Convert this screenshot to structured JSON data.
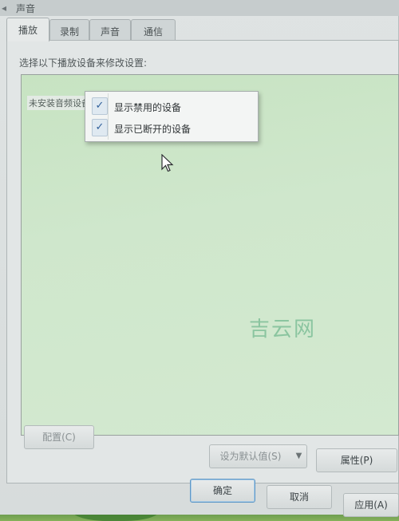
{
  "window": {
    "title": "声音"
  },
  "tabs": [
    {
      "label": "播放",
      "active": true
    },
    {
      "label": "录制",
      "active": false
    },
    {
      "label": "声音",
      "active": false
    },
    {
      "label": "通信",
      "active": false
    }
  ],
  "main": {
    "instruction": "选择以下播放设备来修改设置:",
    "empty_label": "未安装音频设备"
  },
  "context_menu": {
    "items": [
      {
        "label": "显示禁用的设备",
        "checked": true
      },
      {
        "label": "显示已断开的设备",
        "checked": true
      }
    ]
  },
  "buttons": {
    "configure": "配置(C)",
    "set_default": "设为默认值(S)",
    "properties": "属性(P)",
    "ok": "确定",
    "cancel": "取消",
    "apply": "应用(A)"
  },
  "watermark": "吉云网",
  "colors": {
    "list_background": "#cfe7cc",
    "accent_border": "#5e97c6",
    "check": "#2f5f9a"
  }
}
